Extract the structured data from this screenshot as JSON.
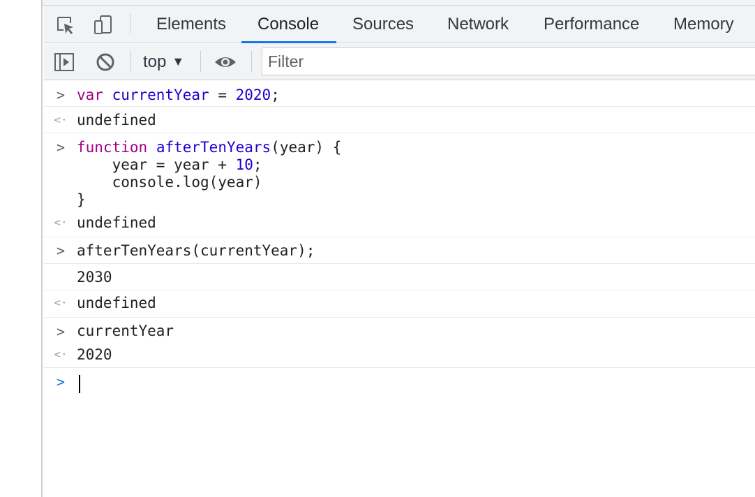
{
  "devtools": {
    "tabs": [
      {
        "label": "Elements"
      },
      {
        "label": "Console"
      },
      {
        "label": "Sources"
      },
      {
        "label": "Network"
      },
      {
        "label": "Performance"
      },
      {
        "label": "Memory"
      }
    ],
    "active_tab": "Console",
    "accent_color": "#1a73e8"
  },
  "console_toolbar": {
    "context": "top",
    "context_arrow": "▼",
    "filter_placeholder": "Filter"
  },
  "console": {
    "entry1": {
      "keyword": "var",
      "variable": "currentYear",
      "op": " = ",
      "number": "2020",
      "end": ";"
    },
    "result1": "undefined",
    "entry2": {
      "l1_keyword": "function",
      "l1_name": "afterTenYears",
      "l1_param": "(year) {",
      "l2_a": "    year = year + ",
      "l2_num": "10",
      "l2_b": ";",
      "l3": "    console.log(year)",
      "l4": "}"
    },
    "result2": "undefined",
    "entry3": "afterTenYears(currentYear);",
    "log3": "2030",
    "result3": "undefined",
    "entry4": "currentYear",
    "result4": "2020"
  }
}
